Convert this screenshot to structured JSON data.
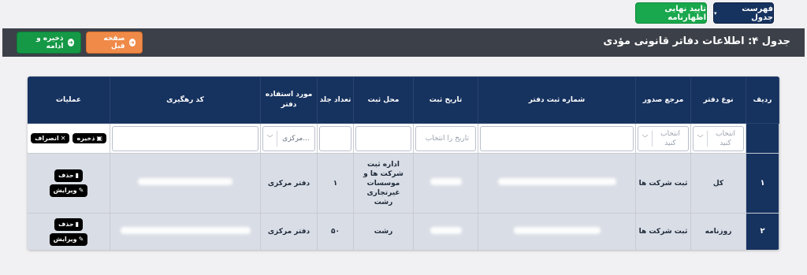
{
  "top_buttons": {
    "list_label": "فهرست جدول",
    "list_caret": "▾",
    "confirm_label": "تایید نهایی اظهارنامه"
  },
  "header": {
    "title": "جدول ۴: اطلاعات دفاتر قانونی مؤدی",
    "prev_label": "صفحه قبل",
    "save_continue_label": "ذخیره و ادامه"
  },
  "table": {
    "columns": [
      "ردیف",
      "نوع دفتر",
      "مرجع صدور",
      "شماره ثبت دفتر",
      "تاریخ ثبت",
      "محل ثبت",
      "تعداد جلد",
      "مورد استفاده دفتر",
      "کد رهگیری",
      "عملیات"
    ],
    "filter": {
      "type_placeholder": "انتخاب کنید",
      "issuer_placeholder": "انتخاب کنید",
      "date_placeholder": "تاریخ را انتخاب",
      "usage_value": "...مرکزی",
      "save_label": "ذخیره",
      "cancel_label": "انصراف"
    },
    "rows": [
      {
        "num": "۱",
        "type": "کل",
        "issuer": "ثبت شرکت ها",
        "place": "اداره ثبت شرکت ها و موسسات غیرتجاری رشت",
        "volumes": "۱",
        "usage": "دفتر مرکزی"
      },
      {
        "num": "۲",
        "type": "روزنامه",
        "issuer": "ثبت شرکت ها",
        "place": "رشت",
        "volumes": "۵۰",
        "usage": "دفتر مرکزی"
      }
    ],
    "row_actions": {
      "delete_label": "حذف",
      "edit_label": "ویرایش"
    }
  },
  "colors": {
    "navy": "#16325f",
    "green": "#19a84d",
    "orange": "#ef8a49",
    "header_bar": "#3c4048",
    "row_bg": "#d9dde5"
  }
}
